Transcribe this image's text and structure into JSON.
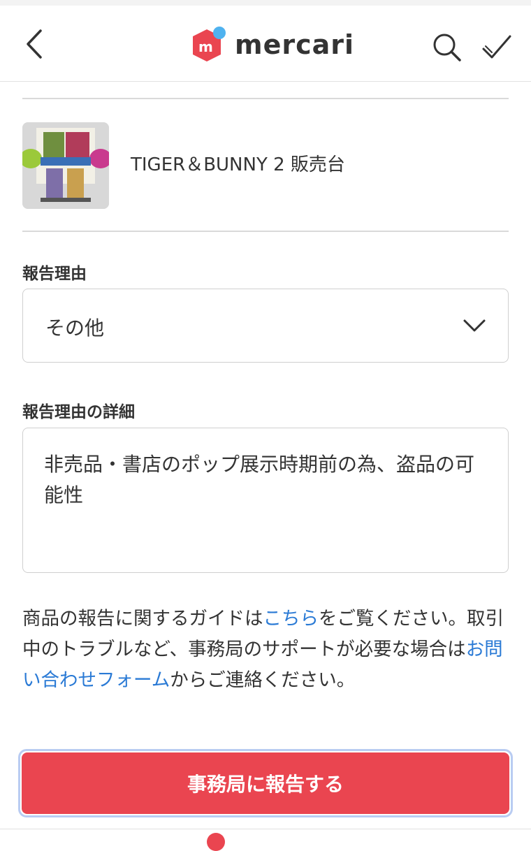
{
  "header": {
    "logo_text": "mercari",
    "back_icon": "chevron-left-icon",
    "search_icon": "search-icon",
    "check_icon": "checkmark-icon"
  },
  "item": {
    "title": "TIGER＆BUNNY 2 販売台",
    "thumbnail_icon": "product-thumbnail"
  },
  "report_reason": {
    "label": "報告理由",
    "selected": "その他",
    "chevron_icon": "chevron-down-icon"
  },
  "report_detail": {
    "label": "報告理由の詳細",
    "value": "非売品・書店のポップ展示時期前の為、盗品の可能性"
  },
  "guide": {
    "part1": "商品の報告に関するガイドは",
    "link1": "こちら",
    "part2": "をご覧ください。取引中のトラブルなど、事務局のサポートが必要な場合は",
    "link2": "お問い合わせフォーム",
    "part3": "からご連絡ください。"
  },
  "submit": {
    "label": "事務局に報告する"
  },
  "colors": {
    "brand_red": "#ea4550",
    "link_blue": "#2a7ad5",
    "logo_blue": "#4fb2ef"
  }
}
